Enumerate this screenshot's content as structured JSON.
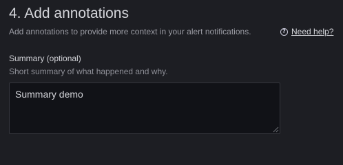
{
  "section": {
    "title": "4. Add annotations",
    "description": "Add annotations to provide more context in your alert notifications.",
    "help_icon": "question-circle-icon",
    "help_label": "Need help?"
  },
  "summary_field": {
    "label": "Summary (optional)",
    "description": "Short summary of what happened and why.",
    "value": "Summary demo",
    "resize_icon": "resize-grip-icon"
  },
  "colors": {
    "background": "#1d1e23",
    "input_background": "#111217",
    "input_border": "#35363d",
    "primary_text": "#d4d5da",
    "secondary_text": "#9a9ba3"
  }
}
